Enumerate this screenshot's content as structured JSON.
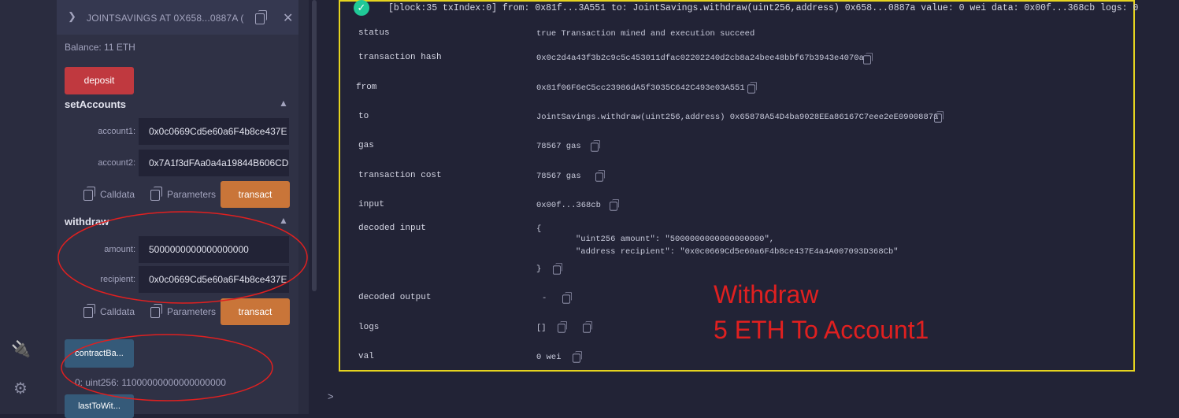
{
  "sidebar": {
    "icons": [
      "plug-icon",
      "gear-icon"
    ]
  },
  "contract": {
    "title": "JOINTSAVINGS AT 0X658...0887A (",
    "balance": "Balance: 11 ETH",
    "deposit_label": "deposit",
    "setAccounts": {
      "title": "setAccounts",
      "account1_label": "account1:",
      "account1_value": "0x0c0669Cd5e60a6F4b8ce437E",
      "account2_label": "account2:",
      "account2_value": "0x7A1f3dFAa0a4a19844B606CD",
      "calldata_label": "Calldata",
      "parameters_label": "Parameters",
      "transact_label": "transact"
    },
    "withdraw": {
      "title": "withdraw",
      "amount_label": "amount:",
      "amount_value": "5000000000000000000",
      "recipient_label": "recipient:",
      "recipient_value": "0x0c0669Cd5e60a6F4b8ce437E",
      "calldata_label": "Calldata",
      "parameters_label": "Parameters",
      "transact_label": "transact"
    },
    "contractBalance_label": "contractBa...",
    "contractBalance_result": "0: uint256: 11000000000000000000",
    "lastToWithdraw_label": "lastToWit..."
  },
  "transaction": {
    "header": "[block:35 txIndex:0]  from: 0x81f...3A551 to: JointSavings.withdraw(uint256,address) 0x658...0887a value: 0 wei data: 0x00f...368cb logs: 0",
    "rows": {
      "status_key": "status",
      "status_val": "true Transaction mined and execution succeed",
      "hash_key": "transaction hash",
      "hash_val": "0x0c2d4a43f3b2c9c5c453011dfac02202240d2cb8a24bee48bbf67b3943e4070a",
      "from_key": "from",
      "from_val": "0x81f06F6eC5cc23986dA5f3035C642C493e03A551",
      "to_key": "to",
      "to_val": "JointSavings.withdraw(uint256,address) 0x65878A54D4ba9028EEa86167C7eee2eE0900887a",
      "gas_key": "gas",
      "gas_val": "78567 gas",
      "cost_key": "transaction cost",
      "cost_val": "78567 gas",
      "input_key": "input",
      "input_val": "0x00f...368cb",
      "decoded_input_key": "decoded input",
      "decoded_input_open": "{",
      "decoded_input_line1": "\"uint256 amount\": \"5000000000000000000\",",
      "decoded_input_line2": "\"address recipient\": \"0x0c0669Cd5e60a6F4b8ce437E4a4A007093D368Cb\"",
      "decoded_input_close": "}",
      "decoded_output_key": "decoded output",
      "decoded_output_val": "-",
      "logs_key": "logs",
      "logs_val": "[]",
      "val_key": "val",
      "val_val": "0 wei"
    }
  },
  "annotation": {
    "line1": "Withdraw",
    "line2": "5 ETH To Account1",
    "color": "#e02020"
  },
  "terminal": {
    "prompt": ">"
  }
}
